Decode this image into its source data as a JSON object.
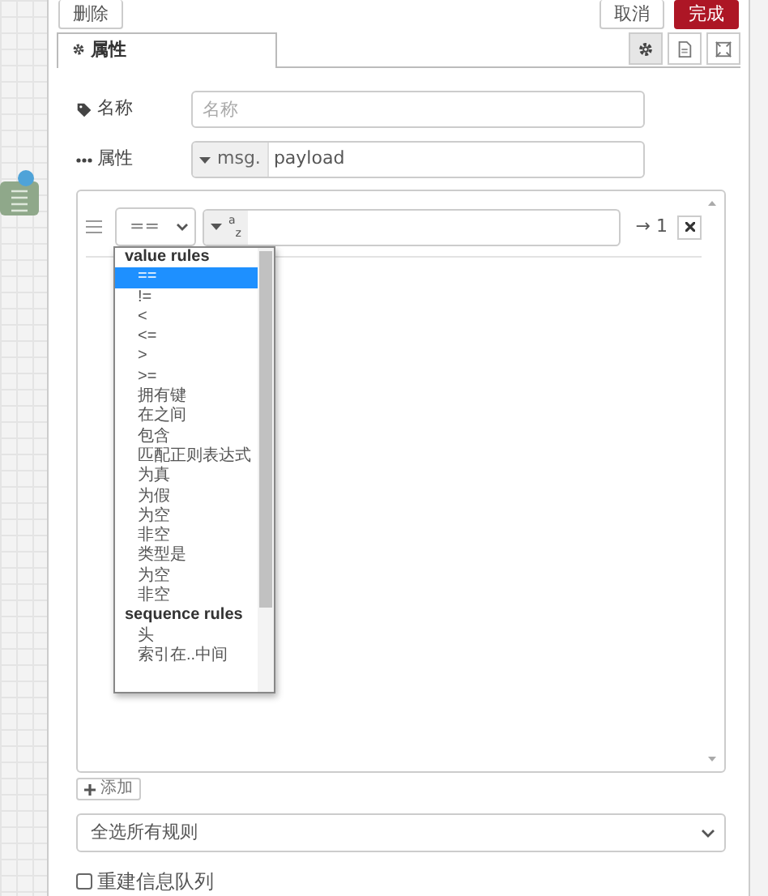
{
  "buttons": [
    {
      "label": "删除",
      "kind": "default"
    },
    {
      "label": "取消",
      "kind": "default"
    },
    {
      "label": "完成",
      "kind": "primary"
    }
  ],
  "tabs": [
    {
      "label": "属性",
      "selected": true
    }
  ],
  "tab_buttons": [
    {
      "kind": "settings",
      "selected": true
    },
    {
      "kind": "description",
      "selected": false
    },
    {
      "kind": "appearance",
      "selected": false
    }
  ],
  "name_field": {
    "label": "名称",
    "placeholder": "名称"
  },
  "property_field": {
    "label": "属性",
    "prefix": "msg.",
    "value": "payload"
  },
  "rules": [
    {
      "operator": "==",
      "value_type": [
        "a",
        "z"
      ],
      "output": "→ 1"
    }
  ],
  "dropdown": {
    "groups": [
      {
        "label": "value rules",
        "options": [
          {
            "label": "==",
            "selected": true
          },
          {
            "label": "!=",
            "selected": false
          },
          {
            "label": "<",
            "selected": false
          },
          {
            "label": "<=",
            "selected": false
          },
          {
            "label": ">",
            "selected": false
          },
          {
            "label": ">=",
            "selected": false
          },
          {
            "label": "拥有键",
            "selected": false
          },
          {
            "label": "在之间",
            "selected": false
          },
          {
            "label": "包含",
            "selected": false
          },
          {
            "label": "匹配正则表达式",
            "selected": false
          },
          {
            "label": "为真",
            "selected": false
          },
          {
            "label": "为假",
            "selected": false
          },
          {
            "label": "为空",
            "selected": false
          },
          {
            "label": "非空",
            "selected": false
          },
          {
            "label": "类型是",
            "selected": false
          },
          {
            "label": "为空",
            "selected": false
          },
          {
            "label": "非空",
            "selected": false
          }
        ]
      },
      {
        "label": "sequence rules",
        "options": [
          {
            "label": "头",
            "selected": false
          },
          {
            "label": "索引在..中间",
            "selected": false
          }
        ]
      }
    ]
  },
  "add_button": "添加",
  "checking_select": "全选所有规则",
  "recreate_checkbox": {
    "label": "重建信息队列",
    "checked": false
  }
}
